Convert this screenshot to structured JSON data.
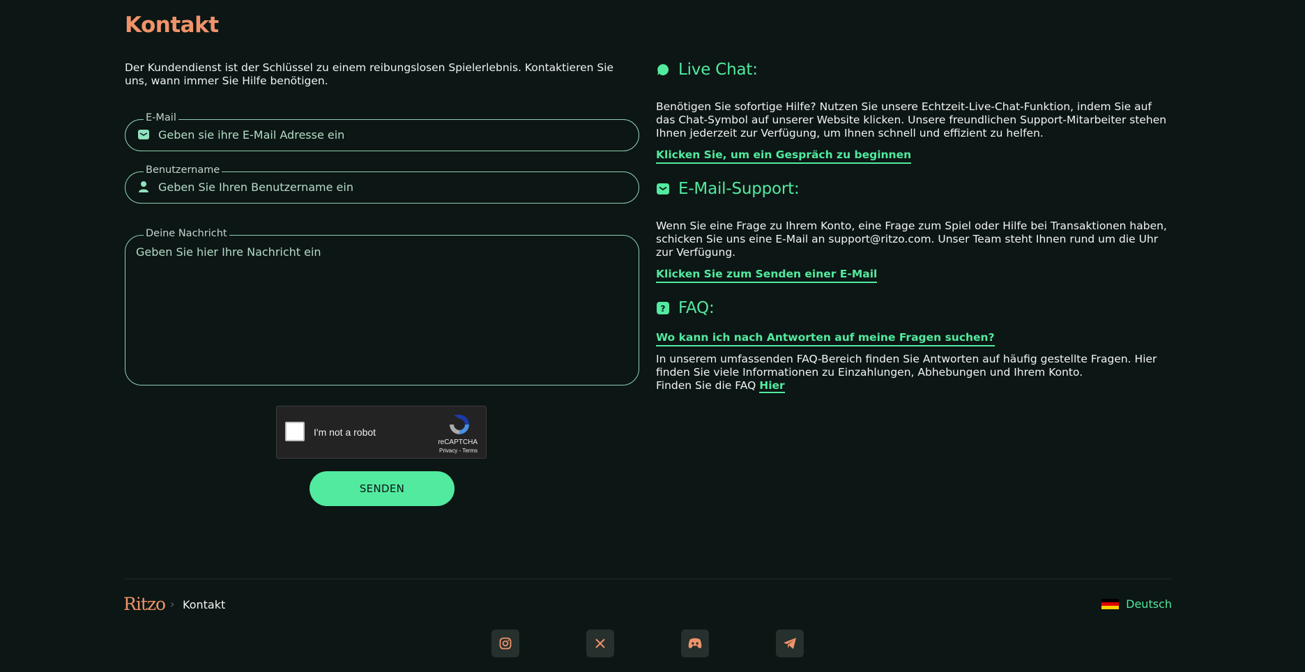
{
  "page": {
    "title": "Kontakt",
    "intro": "Der Kundendienst ist der Schlüssel zu einem reibungslosen Spielerlebnis. Kontaktieren Sie uns, wann immer Sie Hilfe benötigen."
  },
  "form": {
    "email": {
      "label": "E-Mail",
      "placeholder": "Geben sie ihre E-Mail Adresse ein",
      "value": ""
    },
    "username": {
      "label": "Benutzername",
      "placeholder": "Geben Sie Ihren Benutzername ein",
      "value": ""
    },
    "message": {
      "label": "Deine Nachricht",
      "placeholder": "Geben Sie hier Ihre Nachricht ein",
      "value": ""
    },
    "captcha": {
      "label": "I'm not a robot",
      "brand": "reCAPTCHA",
      "privacy": "Privacy",
      "sep": " - ",
      "terms": "Terms",
      "checked": false
    },
    "submit_label": "SENDEN"
  },
  "sections": {
    "chat": {
      "icon": "chat-bubble-icon",
      "title": "Live Chat:",
      "text": "Benötigen Sie sofortige Hilfe? Nutzen Sie unsere Echtzeit-Live-Chat-Funktion, indem Sie auf das Chat-Symbol auf unserer Website klicken. Unsere freundlichen Support-Mitarbeiter stehen Ihnen jederzeit zur Verfügung, um Ihnen schnell und effizient zu helfen.",
      "link": "Klicken Sie, um ein Gespräch zu beginnen"
    },
    "mail": {
      "icon": "envelope-icon",
      "title": "E-Mail-Support:",
      "text": "Wenn Sie eine Frage zu Ihrem Konto, eine Frage zum Spiel oder Hilfe bei Transaktionen haben, schicken Sie uns eine E-Mail an support@ritzo.com. Unser Team steht Ihnen rund um die Uhr zur Verfügung.",
      "link": "Klicken Sie zum Senden einer E-Mail"
    },
    "faq": {
      "icon": "question-icon",
      "title": "FAQ:",
      "link": "Wo kann ich nach Antworten auf meine Fragen suchen?",
      "text": "In unserem umfassenden FAQ-Bereich finden Sie Antworten auf häufig gestellte Fragen. Hier finden Sie viele Informationen zu Einzahlungen, Abhebungen und Ihrem Konto.",
      "find_prefix": "Finden Sie die FAQ ",
      "find_link": "Hier"
    }
  },
  "footer": {
    "logo": "Ritzo",
    "breadcrumb": [
      "Kontakt"
    ],
    "language": "Deutsch",
    "social": [
      "instagram-icon",
      "x-icon",
      "discord-icon",
      "telegram-icon"
    ]
  },
  "colors": {
    "background": "#0c1614",
    "accent": "#52ea9f",
    "brand": "#f0936a"
  }
}
